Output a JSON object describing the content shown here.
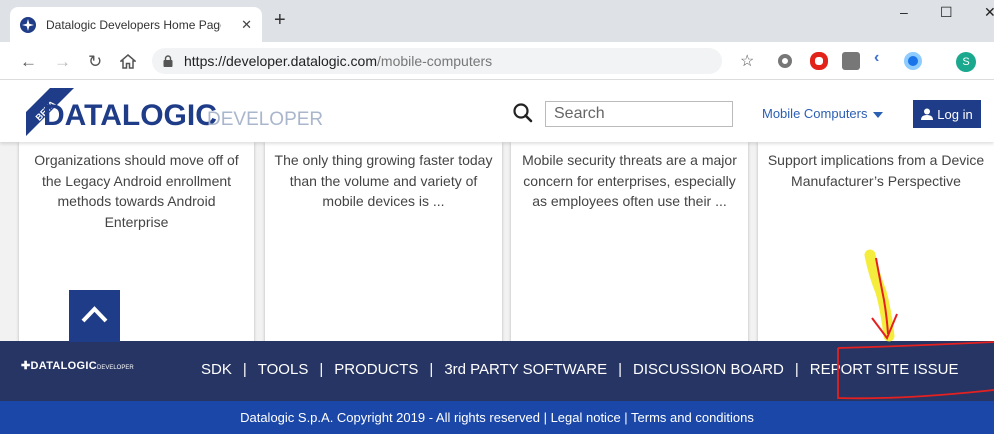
{
  "browser": {
    "tab_title": "Datalogic Developers Home Page",
    "new_tab_label": "+",
    "window_controls": {
      "minimize": "–",
      "maximize": "☐",
      "close": "✕"
    },
    "url_host": "https://developer.datalogic.com",
    "url_path": "/mobile-computers",
    "avatar_letter": "S"
  },
  "header": {
    "logo_beta": "BETA",
    "logo_brand": "DATALOGIC",
    "logo_sub": "DEVELOPER",
    "search_placeholder": "Search",
    "menu_label": "Mobile Computers",
    "login_label": "Log in"
  },
  "cards": [
    {
      "text": "Organizations should move off of the Legacy Android enrollment methods towards Android Enterprise"
    },
    {
      "text": "The only thing growing faster today than the volume and variety of mobile devices is ..."
    },
    {
      "text": "Mobile security threats are a major concern for enterprises, especially as employees often use their ..."
    },
    {
      "text": "Support implications from a Device Manufacturer’s Perspective"
    }
  ],
  "footer": {
    "logo_brand": "DATALOGIC",
    "logo_sub": "DEVELOPER",
    "links": [
      "SDK",
      "TOOLS",
      "PRODUCTS",
      "3rd PARTY SOFTWARE",
      "DISCUSSION BOARD",
      "REPORT SITE ISSUE"
    ],
    "separator": "|",
    "copyright": "Datalogic S.p.A. Copyright 2019 - All rights reserved | Legal notice | Terms and conditions"
  },
  "colors": {
    "brand_navy": "#1f3c88",
    "footer_nav_bg": "#263563",
    "footer_copy_bg": "#1b47a8",
    "annotation_red": "#e52020",
    "annotation_yellow": "#f2ea1b"
  }
}
